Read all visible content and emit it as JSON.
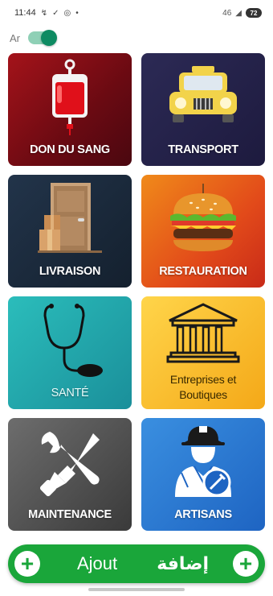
{
  "status_bar": {
    "time": "11:44",
    "signal": "46",
    "battery": "72",
    "icons": [
      "missed-call-icon",
      "check-icon",
      "whatsapp-icon",
      "dot-icon",
      "wifi-icon",
      "signal-icon",
      "battery-icon"
    ]
  },
  "language": {
    "label": "Ar",
    "toggle_on": true
  },
  "tiles": [
    {
      "label": "DON DU SANG",
      "icon": "blood-bag-icon"
    },
    {
      "label": "TRANSPORT",
      "icon": "taxi-icon"
    },
    {
      "label": "LIVRAISON",
      "icon": "delivery-box-icon"
    },
    {
      "label": "RESTAURATION",
      "icon": "burger-icon"
    },
    {
      "label": "SANTÉ",
      "icon": "stethoscope-icon"
    },
    {
      "label_line1": "Entreprises et",
      "label_line2": "Boutiques",
      "icon": "building-icon"
    },
    {
      "label": "MAINTENANCE",
      "icon": "tools-icon"
    },
    {
      "label": "ARTISANS",
      "icon": "worker-icon"
    }
  ],
  "bottom_bar": {
    "label_fr": "Ajout",
    "label_ar": "إضافة",
    "color": "#1aa63a"
  }
}
